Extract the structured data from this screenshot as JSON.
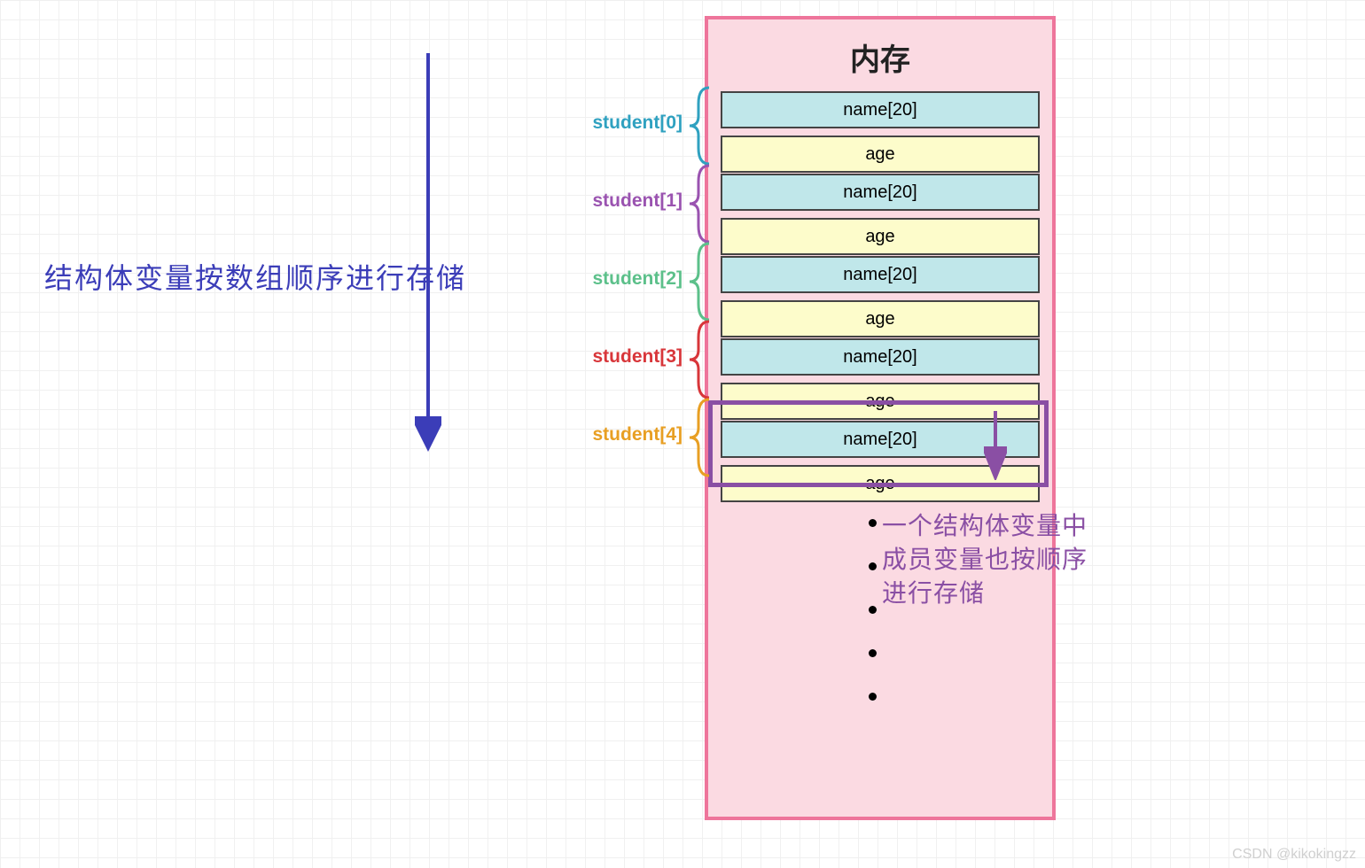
{
  "memory": {
    "title": "内存",
    "slots": [
      {
        "index": 0,
        "label": "student[0]",
        "fields": [
          "name[20]",
          "age"
        ]
      },
      {
        "index": 1,
        "label": "student[1]",
        "fields": [
          "name[20]",
          "age"
        ]
      },
      {
        "index": 2,
        "label": "student[2]",
        "fields": [
          "name[20]",
          "age"
        ]
      },
      {
        "index": 3,
        "label": "student[3]",
        "fields": [
          "name[20]",
          "age"
        ]
      },
      {
        "index": 4,
        "label": "student[4]",
        "fields": [
          "name[20]",
          "age"
        ]
      }
    ]
  },
  "left_caption": "结构体变量按数组顺序进行存储",
  "right_annotation": {
    "line1": "一个结构体变量中",
    "line2": "成员变量也按顺序",
    "line3": "进行存储"
  },
  "watermark": "CSDN @kikokingzz",
  "colors": {
    "label0": "#2fa1c0",
    "label1": "#9a53b0",
    "label2": "#5cc08a",
    "label3": "#d8363a",
    "label4": "#e89f23",
    "box_border": "#ee759b",
    "box_fill": "#fbdae2",
    "name_fill": "#c0e7ea",
    "age_fill": "#fdfccb",
    "arrow": "#3b3db8",
    "annotation": "#8a4fa4"
  }
}
